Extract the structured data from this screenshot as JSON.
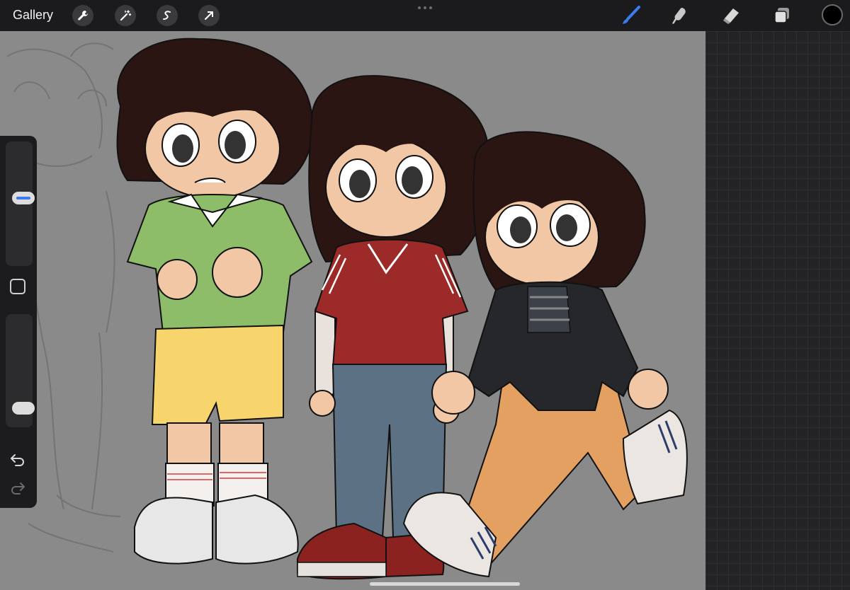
{
  "topbar": {
    "gallery_label": "Gallery",
    "left_tools": [
      "wrench-icon",
      "magic-wand-icon",
      "selection-icon",
      "transform-arrow-icon"
    ],
    "right_tools": [
      "brush-icon",
      "smudge-icon",
      "eraser-icon",
      "layers-icon"
    ],
    "active_tool": "brush-icon",
    "active_color": "#000000"
  },
  "sidebar": {
    "brush_size_level": 0.55,
    "opacity_level": 0.9
  },
  "colors": {
    "topbar_bg": "#1b1b1d",
    "canvas_bg": "#8a8a8a",
    "accent": "#3d7bf0"
  },
  "canvas": {
    "content": "character-illustration"
  }
}
